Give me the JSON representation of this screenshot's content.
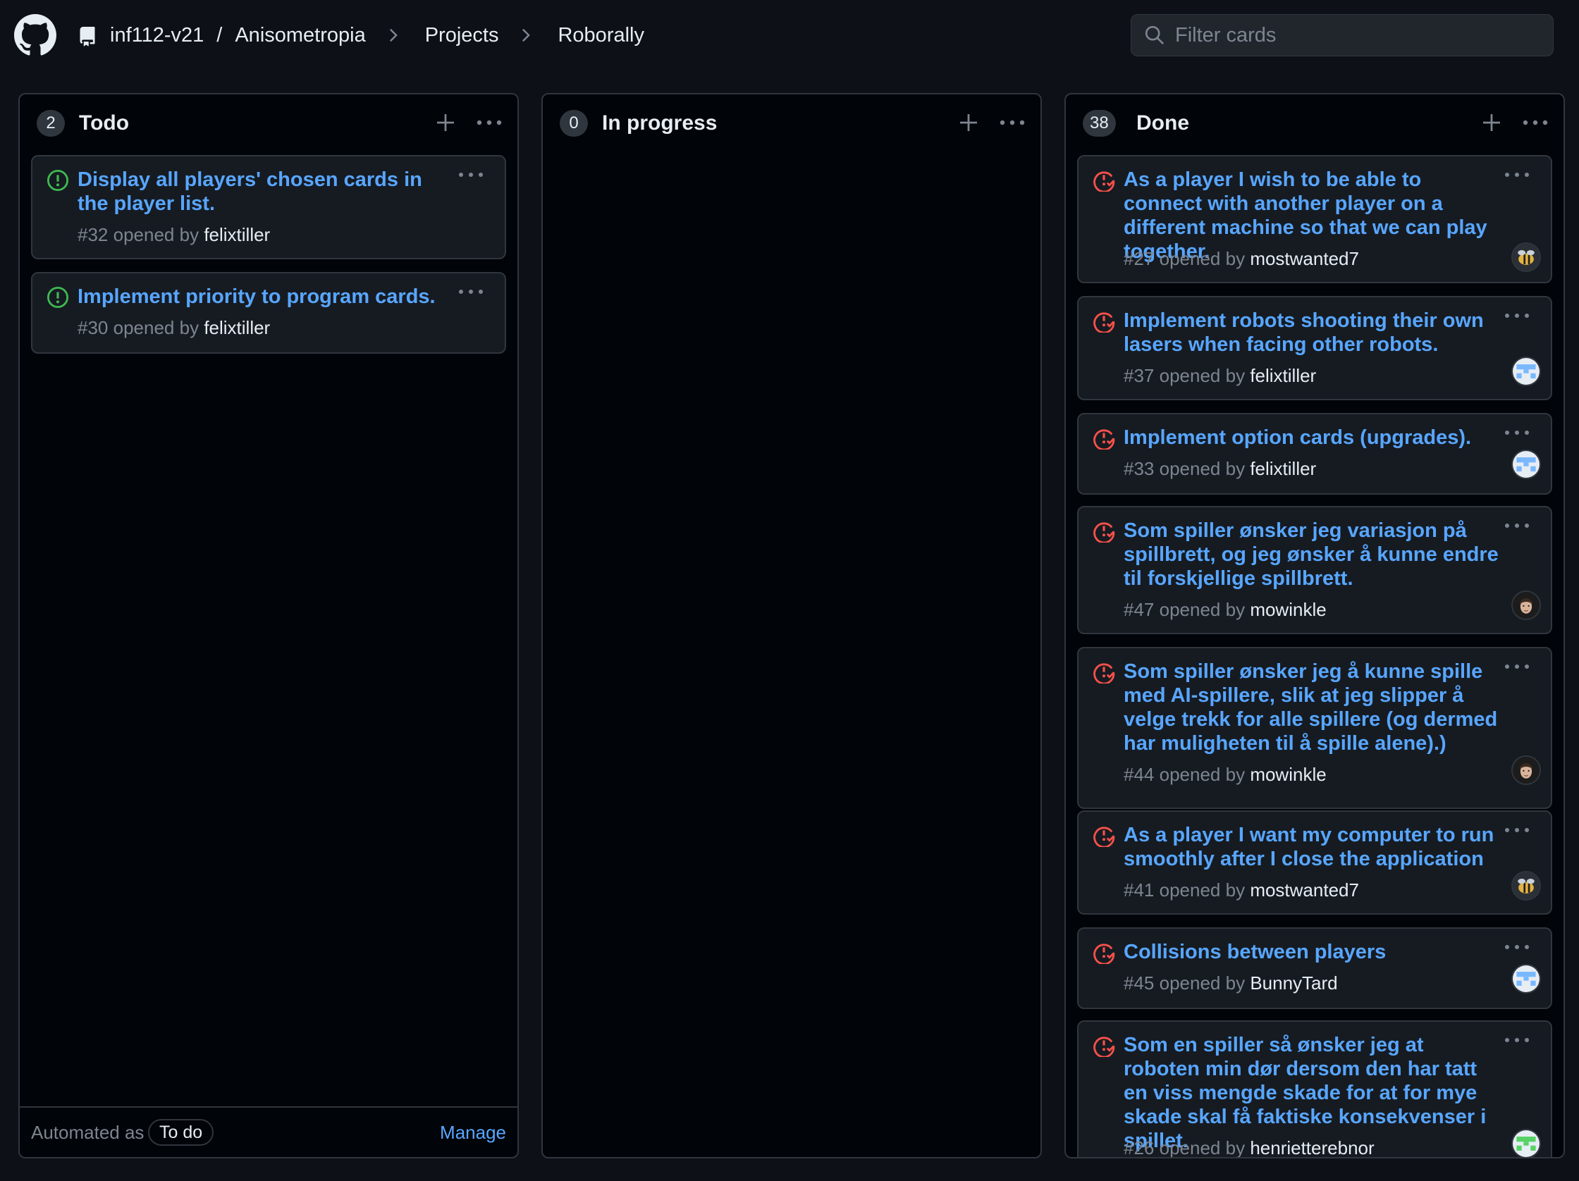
{
  "header": {
    "org": "inf112-v21",
    "slash": "/",
    "repo": "Anisometropia",
    "section": "Projects",
    "project": "Roborally"
  },
  "search": {
    "placeholder": "Filter cards",
    "value": ""
  },
  "colors": {
    "open_issue": "#3fb950",
    "closed_issue": "#f85149",
    "link": "#58a6ff",
    "background": "#0d1117"
  },
  "columns": [
    {
      "count": "2",
      "title": "Todo",
      "footer": {
        "label": "Automated as",
        "pill": "To do",
        "manage": "Manage"
      },
      "cards": [
        {
          "state": "open",
          "title": "Display all players' chosen cards in the player list.",
          "number": "#32",
          "opened_by": "opened by",
          "author": "felixtiller"
        },
        {
          "state": "open",
          "title": "Implement priority to program cards.",
          "number": "#30",
          "opened_by": "opened by",
          "author": "felixtiller"
        }
      ]
    },
    {
      "count": "0",
      "title": "In progress",
      "cards": []
    },
    {
      "count": "38",
      "title": "Done",
      "cards": [
        {
          "state": "closed",
          "title": "As a player I wish to be able to connect with another player on a different machine so that we can play together.",
          "number": "#27",
          "opened_by": "opened by",
          "author": "mostwanted7",
          "avatar": "bee-avatar"
        },
        {
          "state": "closed",
          "title": "Implement robots shooting their own lasers when facing other robots.",
          "number": "#37",
          "opened_by": "opened by",
          "author": "felixtiller",
          "avatar": "pixel-avatar-blue"
        },
        {
          "state": "closed",
          "title": "Implement option cards (upgrades).",
          "number": "#33",
          "opened_by": "opened by",
          "author": "felixtiller",
          "avatar": "pixel-avatar-blue"
        },
        {
          "state": "closed",
          "title": "Som spiller ønsker jeg variasjon på spillbrett, og jeg ønsker å kunne endre til forskjellige spillbrett.",
          "number": "#47",
          "opened_by": "opened by",
          "author": "mowinkle",
          "avatar": "face-avatar"
        },
        {
          "state": "closed",
          "title": "Som spiller ønsker jeg å kunne spille med AI-spillere, slik at jeg slipper å velge trekk for alle spillere (og dermed har muligheten til å spille alene).)",
          "number": "#44",
          "opened_by": "opened by",
          "author": "mowinkle",
          "avatar": "face-avatar"
        },
        {
          "state": "closed",
          "title": "As a player I want my computer to run smoothly after I close the application",
          "number": "#41",
          "opened_by": "opened by",
          "author": "mostwanted7",
          "avatar": "bee-avatar"
        },
        {
          "state": "closed",
          "title": "Collisions between players",
          "number": "#45",
          "opened_by": "opened by",
          "author": "BunnyTard",
          "avatar": "pixel-avatar-blue"
        },
        {
          "state": "closed",
          "title": "Som en spiller så ønsker jeg at roboten min dør dersom den har tatt en viss mengde skade for at for mye skade skal få faktiske konsekvenser i spillet.",
          "number": "#26",
          "opened_by": "opened by",
          "author": "henrietterebnor",
          "avatar": "pixel-avatar-green"
        }
      ]
    }
  ]
}
